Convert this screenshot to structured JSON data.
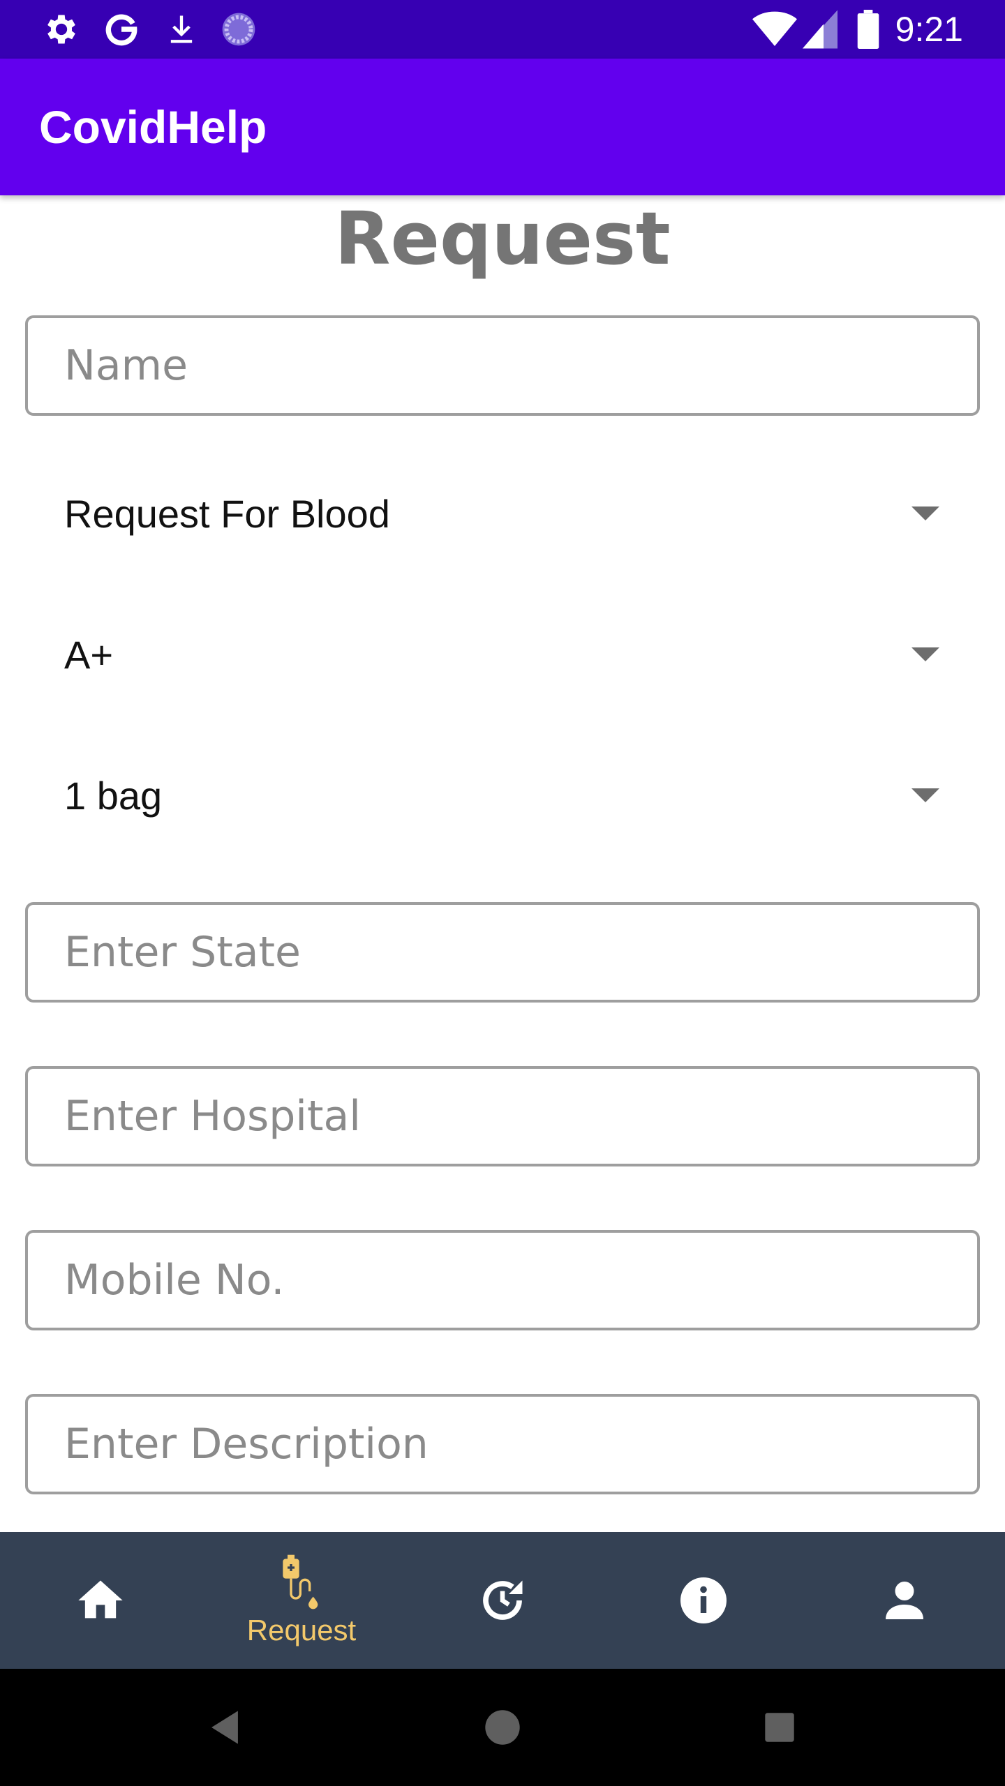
{
  "status_bar": {
    "time": "9:21",
    "left_icons": [
      "settings-icon",
      "google-icon",
      "download-icon",
      "loading-icon"
    ],
    "right_icons": [
      "wifi-icon",
      "signal-icon",
      "battery-icon"
    ]
  },
  "app_bar": {
    "title": "CovidHelp"
  },
  "page": {
    "heading": "Request"
  },
  "form": {
    "name_placeholder": "Name",
    "request_type": "Request For Blood",
    "blood_group": "A+",
    "quantity": "1 bag",
    "state_placeholder": "Enter State",
    "hospital_placeholder": "Enter Hospital",
    "mobile_placeholder": "Mobile No.",
    "description_placeholder": "Enter Description"
  },
  "bottom_nav": {
    "items": [
      {
        "icon": "home-icon",
        "label": ""
      },
      {
        "icon": "iv-bag-icon",
        "label": "Request",
        "active": true
      },
      {
        "icon": "history-icon",
        "label": ""
      },
      {
        "icon": "info-icon",
        "label": ""
      },
      {
        "icon": "profile-icon",
        "label": ""
      }
    ],
    "active_color": "#f3c96b",
    "background": "#344154"
  },
  "colors": {
    "status_bar": "#3700b3",
    "app_bar": "#6200ee",
    "heading": "#757575"
  }
}
